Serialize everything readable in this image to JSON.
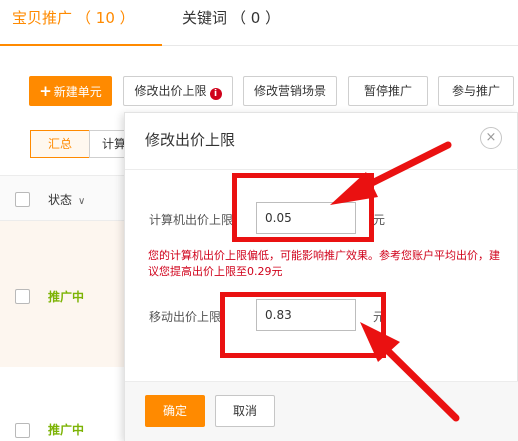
{
  "tabs": [
    {
      "label": "宝贝推广",
      "count": "（ 10 ）"
    },
    {
      "label": "关键词",
      "count": "（ 0 ）"
    }
  ],
  "toolbar": {
    "new_unit": "新建单元",
    "modify_limit": "修改出价上限",
    "modify_scene": "修改营销场景",
    "pause": "暂停推广",
    "join": "参与推广"
  },
  "subtabs": [
    "汇总",
    "计算"
  ],
  "table": {
    "status_header": "状态",
    "rows": [
      {
        "status": "推广中"
      },
      {
        "status": "推广中"
      }
    ]
  },
  "modal": {
    "title": "修改出价上限",
    "pc_label": "计算机出价上限：",
    "pc_value": "0.05",
    "pc_unit": "元",
    "warning": "您的计算机出价上限偏低，可能影响推广效果。参考您账户平均出价，建议您提高出价上限至0.29元",
    "mobile_label": "移动出价上限：",
    "mobile_value": "0.83",
    "mobile_unit": "元",
    "ok": "确定",
    "cancel": "取消"
  },
  "colors": {
    "accent": "#ff8a00",
    "warning": "#d0021b",
    "status_green": "#7cb305",
    "annotation": "#ea1111"
  }
}
